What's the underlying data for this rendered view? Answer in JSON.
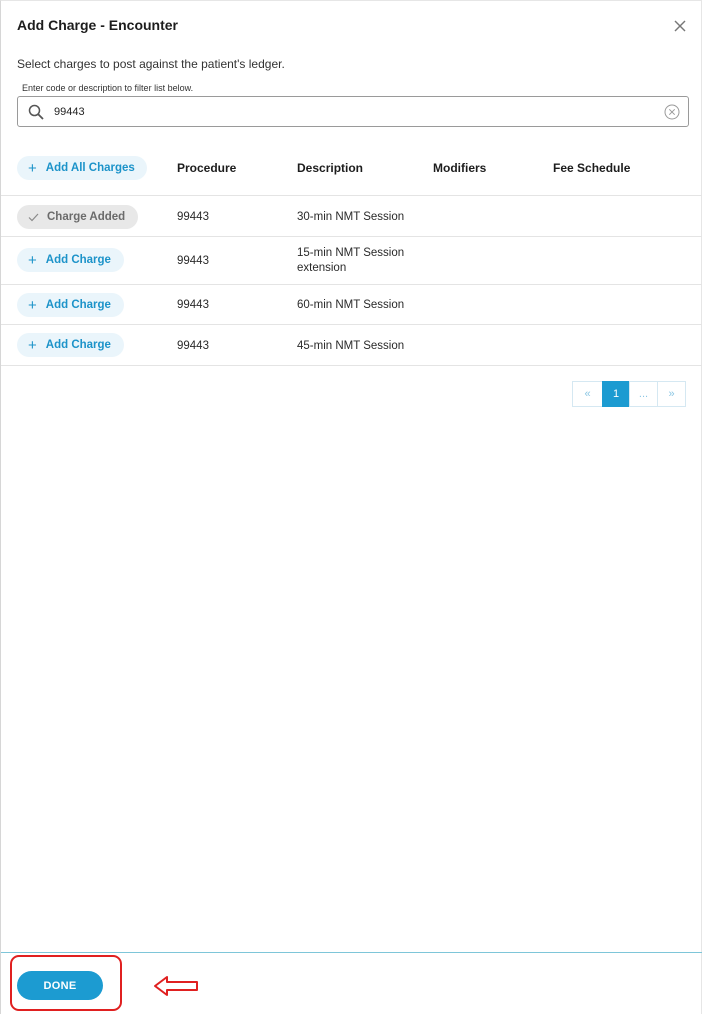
{
  "dialog": {
    "title": "Add Charge - Encounter",
    "subtitle": "Select charges to post against the patient's ledger.",
    "filter_label": "Enter code or description to filter list below.",
    "search_value": "99443"
  },
  "table": {
    "add_all_label": "Add All Charges",
    "columns": [
      "Procedure",
      "Description",
      "Modifiers",
      "Fee Schedule"
    ],
    "rows": [
      {
        "action": "Charge Added",
        "added": true,
        "procedure": "99443",
        "description": "30-min NMT Session",
        "modifiers": "",
        "fee_schedule": ""
      },
      {
        "action": "Add Charge",
        "added": false,
        "procedure": "99443",
        "description": "15-min NMT Session extension",
        "modifiers": "",
        "fee_schedule": ""
      },
      {
        "action": "Add Charge",
        "added": false,
        "procedure": "99443",
        "description": "60-min NMT Session",
        "modifiers": "",
        "fee_schedule": ""
      },
      {
        "action": "Add Charge",
        "added": false,
        "procedure": "99443",
        "description": "45-min NMT Session",
        "modifiers": "",
        "fee_schedule": ""
      }
    ]
  },
  "pagination": {
    "first": "«",
    "current": "1",
    "more": "...",
    "last": "»"
  },
  "footer": {
    "done_label": "DONE"
  },
  "colors": {
    "accent": "#1c9bd1",
    "pill_bg": "#eaf5fb",
    "annotation": "#e02020"
  }
}
